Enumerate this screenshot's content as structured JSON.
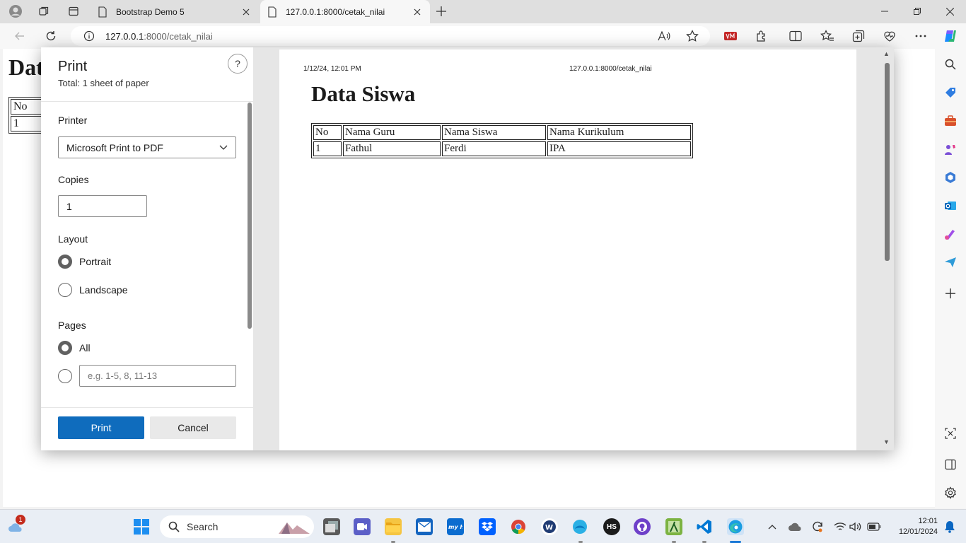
{
  "browser": {
    "tabs": [
      {
        "title": "Bootstrap Demo 5",
        "active": false
      },
      {
        "title": "127.0.0.1:8000/cetak_nilai",
        "active": true
      }
    ],
    "address": {
      "host": "127.0.0.1",
      "path": ":8000/cetak_nilai"
    }
  },
  "page": {
    "title_partial": "Dat",
    "table_partial": [
      [
        "No"
      ],
      [
        "1"
      ]
    ]
  },
  "print_dialog": {
    "title": "Print",
    "total": "Total: 1 sheet of paper",
    "help": "?",
    "printer_label": "Printer",
    "printer_value": "Microsoft Print to PDF",
    "copies_label": "Copies",
    "copies_value": "1",
    "layout_label": "Layout",
    "layout_options": [
      {
        "label": "Portrait",
        "checked": true
      },
      {
        "label": "Landscape",
        "checked": false
      }
    ],
    "pages_label": "Pages",
    "pages_options": [
      {
        "label": "All",
        "checked": true
      }
    ],
    "pages_range_placeholder": "e.g. 1-5, 8, 11-13",
    "print_button": "Print",
    "cancel_button": "Cancel"
  },
  "preview": {
    "header_date": "1/12/24, 12:01 PM",
    "header_url": "127.0.0.1:8000/cetak_nilai",
    "heading": "Data Siswa",
    "table": {
      "headers": [
        "No",
        "Nama Guru",
        "Nama Siswa",
        "Nama Kurikulum"
      ],
      "rows": [
        [
          "1",
          "Fathul",
          "Ferdi",
          "IPA"
        ]
      ]
    }
  },
  "taskbar": {
    "search_label": "Search",
    "time": "12:01",
    "date": "12/01/2024",
    "weather_badge": "1",
    "app_labels": {
      "hs": "HS"
    }
  },
  "colors": {
    "accent": "#0f6cbd",
    "tabstrip": "#dfdfdf",
    "taskbar": "#e9eef5"
  }
}
